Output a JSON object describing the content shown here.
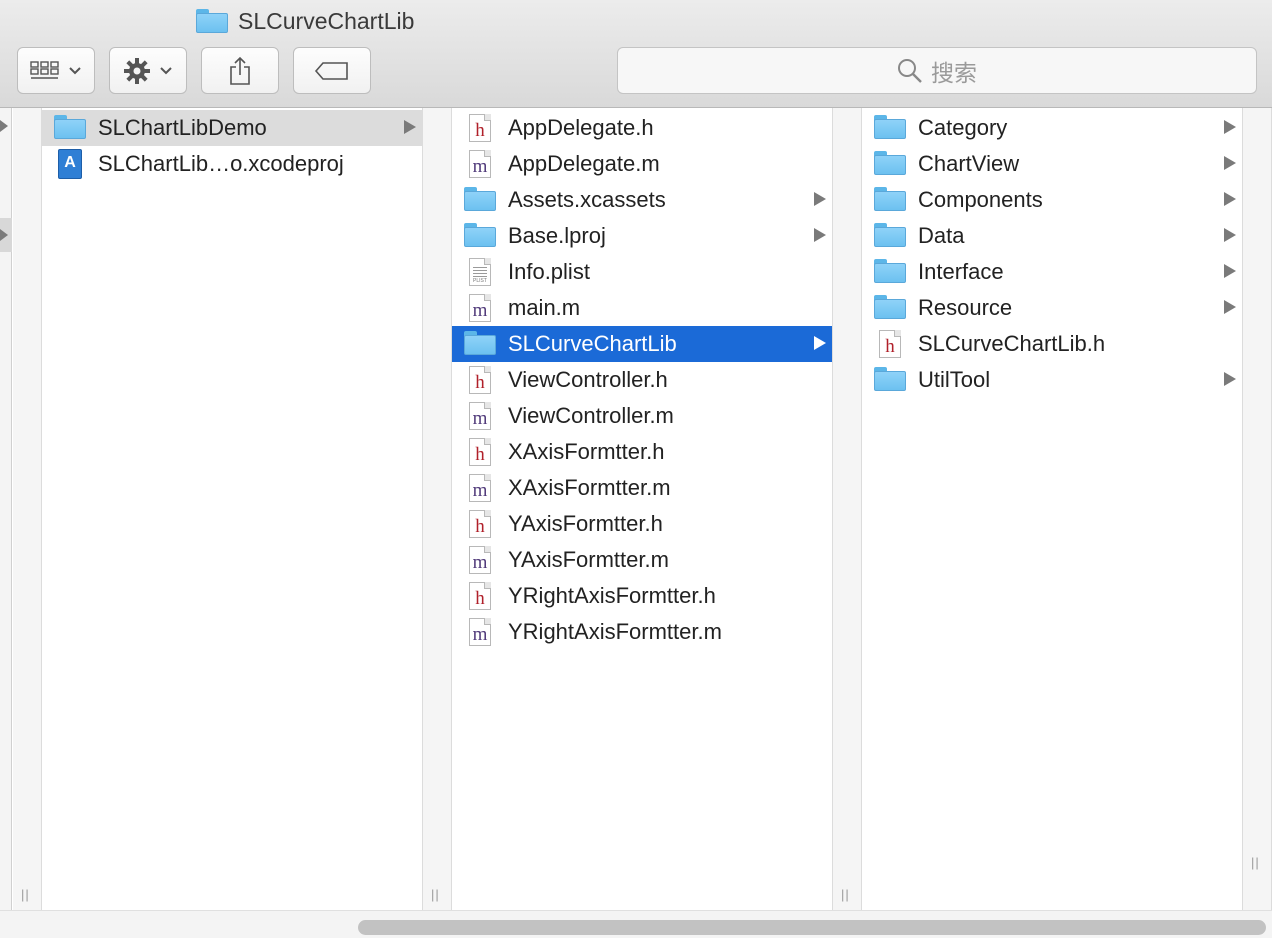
{
  "window": {
    "title": "SLCurveChartLib"
  },
  "toolbar": {
    "view_icon": "column-view-icon",
    "action_icon": "gear-icon",
    "share_icon": "share-icon",
    "tag_icon": "tag-icon",
    "search_placeholder": "搜索"
  },
  "columns": [
    {
      "items": [
        {
          "name": "SLChartLibDemo",
          "type": "folder",
          "has_children": true,
          "selected": "gray"
        },
        {
          "name": "SLChartLib…o.xcodeproj",
          "type": "xcodeproj",
          "has_children": false
        }
      ]
    },
    {
      "items": [
        {
          "name": "AppDelegate.h",
          "type": "h",
          "has_children": false
        },
        {
          "name": "AppDelegate.m",
          "type": "m",
          "has_children": false
        },
        {
          "name": "Assets.xcassets",
          "type": "folder",
          "has_children": true
        },
        {
          "name": "Base.lproj",
          "type": "folder",
          "has_children": true
        },
        {
          "name": "Info.plist",
          "type": "plist",
          "has_children": false
        },
        {
          "name": "main.m",
          "type": "m",
          "has_children": false
        },
        {
          "name": "SLCurveChartLib",
          "type": "folder",
          "has_children": true,
          "selected": "blue"
        },
        {
          "name": "ViewController.h",
          "type": "h",
          "has_children": false
        },
        {
          "name": "ViewController.m",
          "type": "m",
          "has_children": false
        },
        {
          "name": "XAxisFormtter.h",
          "type": "h",
          "has_children": false
        },
        {
          "name": "XAxisFormtter.m",
          "type": "m",
          "has_children": false
        },
        {
          "name": "YAxisFormtter.h",
          "type": "h",
          "has_children": false
        },
        {
          "name": "YAxisFormtter.m",
          "type": "m",
          "has_children": false
        },
        {
          "name": "YRightAxisFormtter.h",
          "type": "h",
          "has_children": false
        },
        {
          "name": "YRightAxisFormtter.m",
          "type": "m",
          "has_children": false
        }
      ]
    },
    {
      "items": [
        {
          "name": "Category",
          "type": "folder",
          "has_children": true
        },
        {
          "name": "ChartView",
          "type": "folder",
          "has_children": true
        },
        {
          "name": "Components",
          "type": "folder",
          "has_children": true
        },
        {
          "name": "Data",
          "type": "folder",
          "has_children": true
        },
        {
          "name": "Interface",
          "type": "folder",
          "has_children": true
        },
        {
          "name": "Resource",
          "type": "folder",
          "has_children": true
        },
        {
          "name": "SLCurveChartLib.h",
          "type": "h",
          "has_children": false
        },
        {
          "name": "UtilTool",
          "type": "folder",
          "has_children": true
        }
      ]
    }
  ],
  "colors": {
    "selection_blue": "#1b6ad7",
    "selection_gray": "#dcdcdc",
    "folder": "#6cc1f0"
  }
}
